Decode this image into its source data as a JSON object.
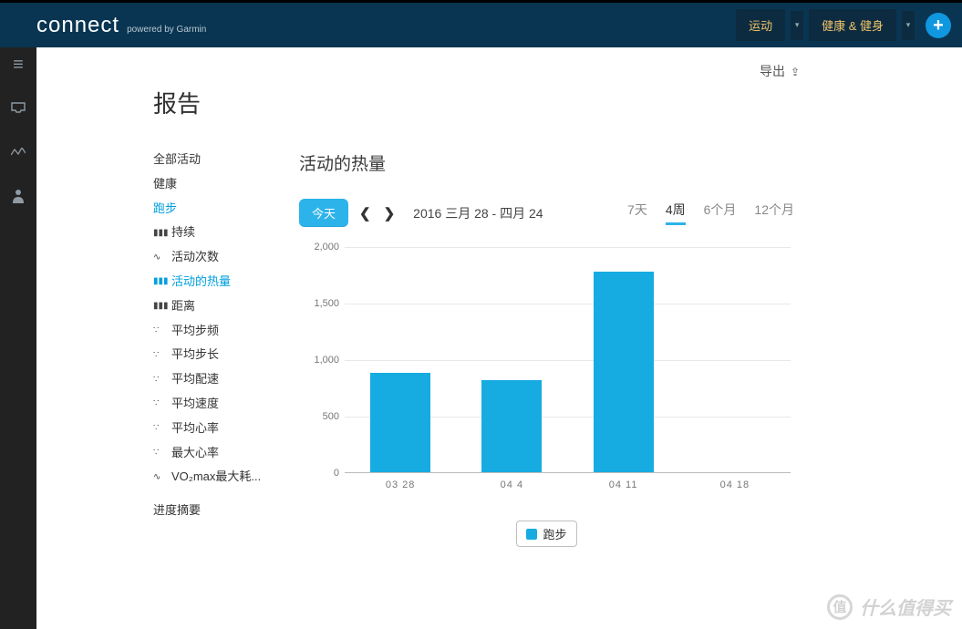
{
  "header": {
    "logo_main": "connect",
    "logo_sub": "powered by Garmin",
    "nav1": "运动",
    "nav2": "健康 & 健身",
    "plus": "+"
  },
  "iconbar": {
    "menu": "≡",
    "inbox_name": "inbox-icon",
    "activity_name": "activity-icon",
    "profile_name": "profile-icon"
  },
  "export_label": "导出",
  "page_title": "报告",
  "sidebar": {
    "all_activities": "全部活动",
    "health": "健康",
    "running": "跑步",
    "subs": [
      "持续",
      "活动次数",
      "活动的热量",
      "距离",
      "平均步频",
      "平均步长",
      "平均配速",
      "平均速度",
      "平均心率",
      "最大心率",
      "VO₂max最大耗..."
    ],
    "progress_summary": "进度摘要"
  },
  "chart": {
    "title": "活动的热量",
    "today": "今天",
    "date_range": "2016 三月 28 - 四月 24",
    "periods": [
      "7天",
      "4周",
      "6个月",
      "12个月"
    ],
    "active_period_index": 1,
    "legend": "跑步"
  },
  "chart_data": {
    "type": "bar",
    "title": "活动的热量",
    "xlabel": "",
    "ylabel": "",
    "ylim": [
      0,
      2000
    ],
    "y_ticks": [
      0,
      500,
      1000,
      1500,
      2000
    ],
    "categories": [
      "03 28",
      "04 4",
      "04 11",
      "04 18"
    ],
    "series": [
      {
        "name": "跑步",
        "values": [
          880,
          820,
          1780,
          0
        ]
      }
    ]
  },
  "watermark": {
    "badge": "值",
    "text": "什么值得买"
  }
}
